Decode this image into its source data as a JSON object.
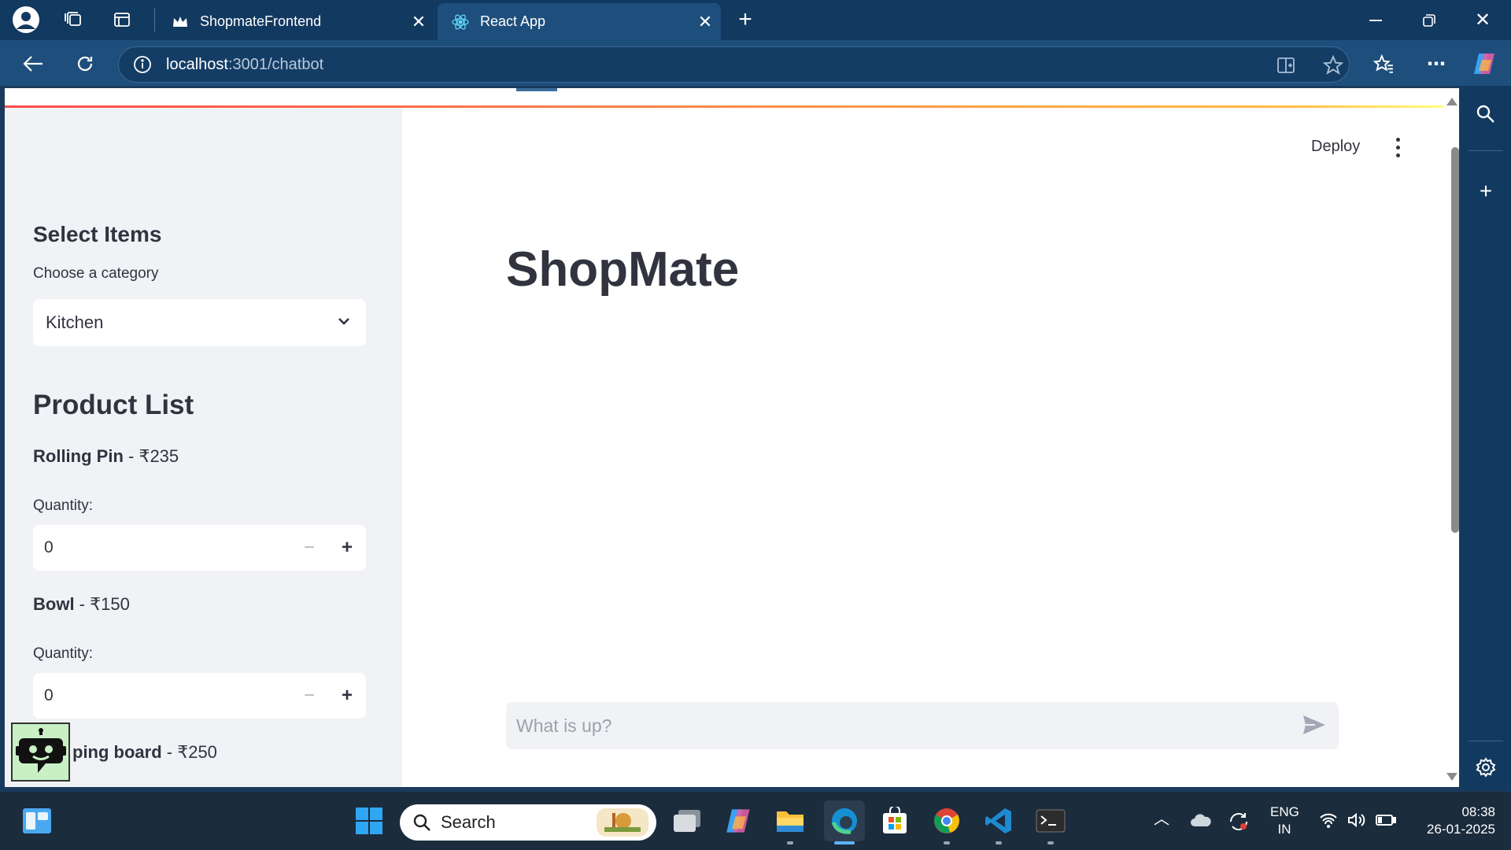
{
  "browser": {
    "tabs": [
      {
        "title": "ShopmateFrontend",
        "active": false
      },
      {
        "title": "React App",
        "active": true
      }
    ],
    "address": {
      "host": "localhost",
      "rest": ":3001/chatbot"
    }
  },
  "app": {
    "deploy_label": "Deploy",
    "title": "ShopMate",
    "chat_placeholder": "What is up?"
  },
  "sidebar": {
    "select_heading": "Select Items",
    "category_label": "Choose a category",
    "category_value": "Kitchen",
    "product_heading": "Product List",
    "products": [
      {
        "name": "Rolling Pin",
        "price": " - ₹235",
        "quantity_label": "Quantity:",
        "quantity": "0"
      },
      {
        "name": "Bowl",
        "price": " - ₹150",
        "quantity_label": "Quantity:",
        "quantity": "0"
      },
      {
        "name": "ping board",
        "price": " - ₹250"
      }
    ]
  },
  "taskbar": {
    "search_label": "Search",
    "lang_line1": "ENG",
    "lang_line2": "IN",
    "time": "08:38",
    "date": "26-01-2025"
  },
  "colors": {
    "accent_gradient_start": "#ff4b4b",
    "accent_gradient_end": "#fffd80",
    "edge_frame": "#1e4e7c"
  }
}
